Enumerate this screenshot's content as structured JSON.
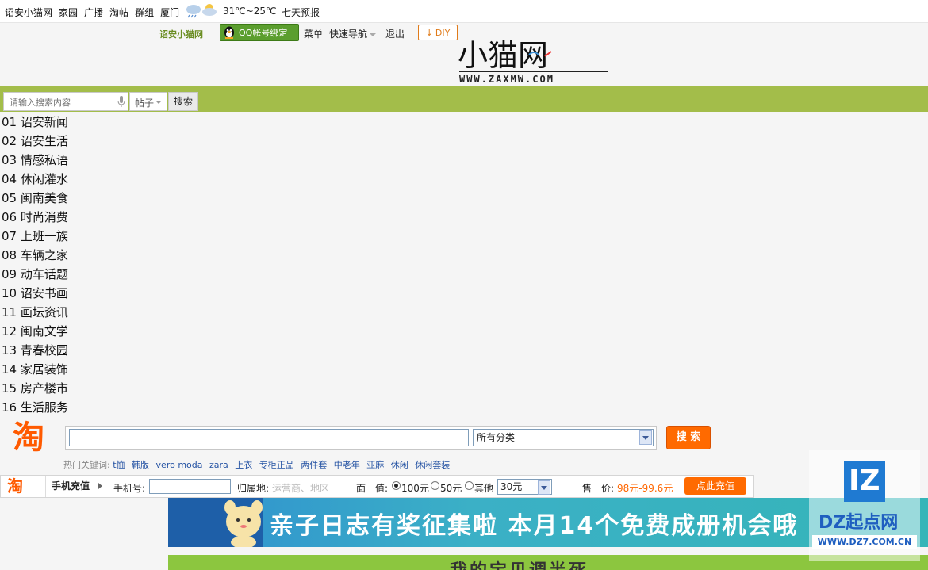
{
  "topbar": {
    "links": [
      "诏安小猫网",
      "家园",
      "广播",
      "淘帖",
      "群组",
      "厦门"
    ],
    "temperature": "31℃~25℃",
    "forecast": "七天预报"
  },
  "header": {
    "site_name": "诏安小猫网",
    "qq_bind": "QQ帐号绑定",
    "menu": "菜单",
    "quick_nav": "快速导航",
    "logout": "退出",
    "diy": "DIY",
    "logo_text": "小猫网",
    "logo_url": "WWW.ZAXMW.COM"
  },
  "search": {
    "placeholder": "请输入搜索内容",
    "scope": "帖子",
    "button": "搜索"
  },
  "forums": [
    "01 诏安新闻",
    "02 诏安生活",
    "03 情感私语",
    "04 休闲灌水",
    "05 闽南美食",
    "06 时尚消费",
    "07 上班一族",
    "08 车辆之家",
    "09 动车话题",
    "10 诏安书画",
    "11 画坛资讯",
    "12 闽南文学",
    "13 青春校园",
    "14 家居装饰",
    "15 房产楼市",
    "16 生活服务"
  ],
  "taobao": {
    "logo": "淘",
    "category": "所有分类",
    "button": "搜 索",
    "hot_label": "热门关键词:",
    "hot_words": [
      "t恤",
      "韩版",
      "vero moda",
      "zara",
      "上衣",
      "专柜正品",
      "两件套",
      "中老年",
      "亚麻",
      "休闲",
      "休闲套装"
    ]
  },
  "recharge": {
    "logo": "淘",
    "tab": "手机充值",
    "phone_label": "手机号:",
    "area_label": "归属地:",
    "area_placeholder": "运营商、地区",
    "face_label": "面　值:",
    "options": [
      "100元",
      "50元",
      "其他"
    ],
    "selected_option": "100元",
    "amount": "30元",
    "price_label": "售　价:",
    "price": "98元-99.6元",
    "pay_button": "点此充值"
  },
  "banners": {
    "banner1_text": "亲子日志有奖征集啦 本月14个免费成册机会哦",
    "banner2_text": "我的宝贝调半死"
  },
  "watermark": {
    "logo": "IZ",
    "brand": "DZ起点网",
    "url": "WWW.DZ7.COM.CN"
  },
  "colors": {
    "green_bar": "#a3bd4a",
    "orange": "#ff6a00",
    "link_blue": "#2452a3"
  }
}
